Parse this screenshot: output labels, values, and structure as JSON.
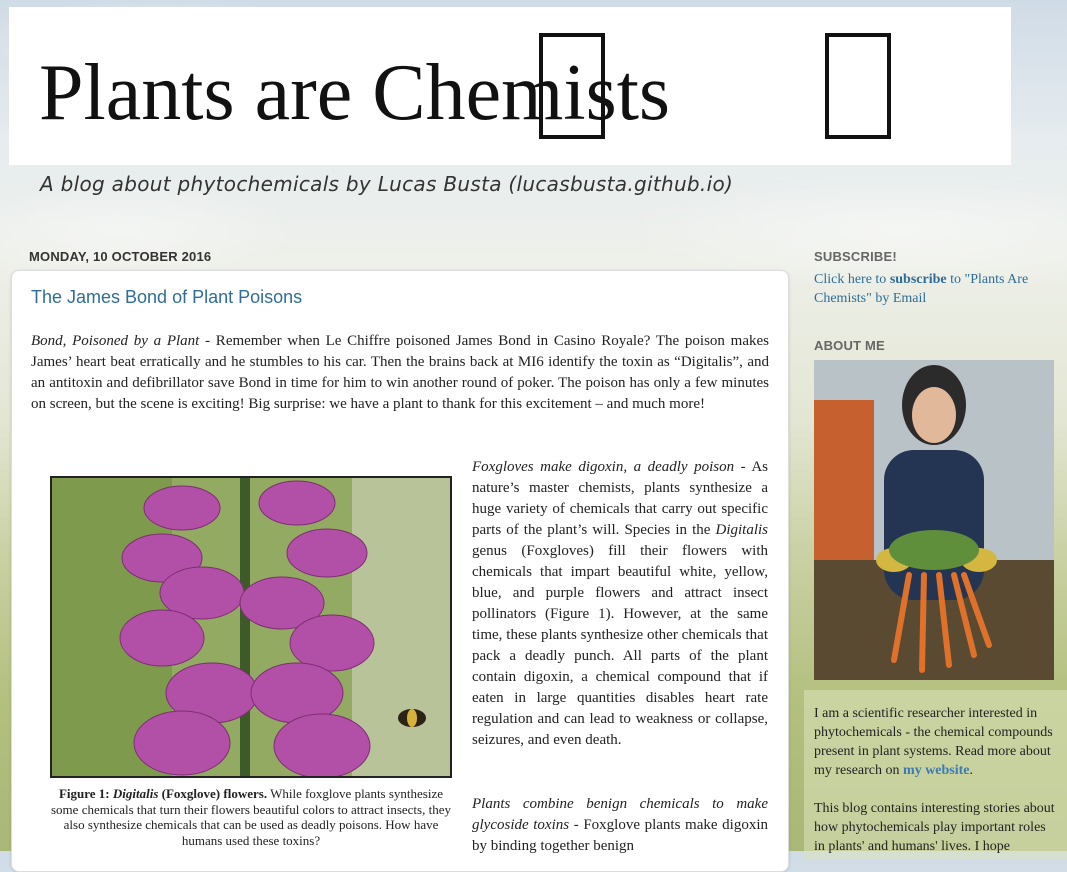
{
  "blog": {
    "title": "Plants are Chemists",
    "tagline": "A blog about phytochemicals by Lucas Busta (lucasbusta.github.io)"
  },
  "post": {
    "date": "MONDAY, 10 OCTOBER 2016",
    "title": "The James Bond of Plant Poisons",
    "intro_lead": "Bond, Poisoned by a Plant",
    "intro_body": " - Remember when Le Chiffre poisoned James Bond in Casino Royale? The poison makes James’ heart beat erratically and he stumbles to his car. Then the brains back at MI6 identify the toxin as “Digitalis”, and an antitoxin and defibrillator save Bond in time for him to win another round of poker. The poison has only a few minutes on screen, but the scene is exciting! Big surprise: we have a plant to thank for this excitement – and much more!",
    "section1_lead": "Foxgloves make digoxin, a deadly poison",
    "section1_body_a": " - As nature’s master chemists, plants synthesize a huge variety of chemicals that carry out specific parts of the plant’s will. Species in the ",
    "section1_genus": "Digitalis",
    "section1_body_b": " genus (Foxgloves) fill their flowers with chemicals that impart beautiful white, yellow, blue, and purple flowers and attract insect pollinators (Figure 1). However, at the same time, these plants synthesize other chemicals that pack a deadly punch. All parts of the plant contain digoxin, a chemical compound that if eaten in large quantities disables heart rate regulation and can lead to weakness or collapse, seizures, and even death.",
    "section2_lead": "Plants combine benign chemicals to make glycoside toxins",
    "section2_body": " - Foxglove plants make digoxin by binding together benign",
    "figure": {
      "label": "Figure 1: ",
      "genus": "Digitalis",
      "name": " (Foxglove) flowers.",
      "caption": " While foxglove plants synthesize some chemicals that turn their flowers beautiful colors to attract insects, they also synthesize chemicals that can be used as deadly poisons. How have humans used these toxins?"
    }
  },
  "sidebar": {
    "subscribe_heading": "SUBSCRIBE!",
    "subscribe_pre": "Click here to ",
    "subscribe_bold": "subscribe",
    "subscribe_post": " to \"Plants Are Chemists\" by Email",
    "about_heading": "ABOUT ME",
    "about_text": "I am a scientific researcher interested in phytochemicals - the chemical compounds present in plant systems. Read more about my research on ",
    "about_link": "my website",
    "about_end": ".",
    "about_text2": "This blog contains interesting stories about how phytochemicals play important roles in plants' and humans' lives. I hope"
  },
  "colors": {
    "link": "#2f6d96",
    "post_bg": "#ffffff",
    "flower": "#b24fa6"
  }
}
